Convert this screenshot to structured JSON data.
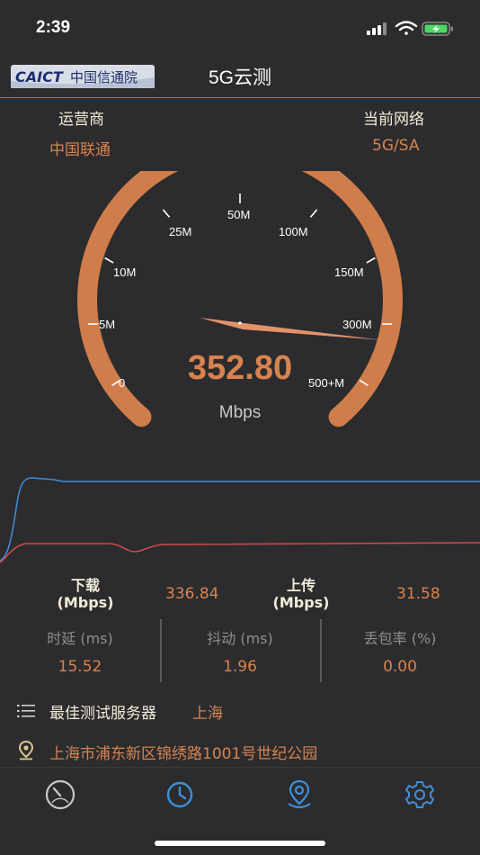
{
  "status_bar": {
    "time": "2:39"
  },
  "header": {
    "logo_text": "CAICT",
    "logo_cn": "中国信通院",
    "title": "5G云测"
  },
  "info": {
    "carrier_label": "运营商",
    "carrier_value": "中国联通",
    "network_label": "当前网络",
    "network_value": "5G/SA"
  },
  "gauge": {
    "tick_labels": [
      "0",
      "5M",
      "10M",
      "25M",
      "50M",
      "100M",
      "150M",
      "300M",
      "500+M"
    ],
    "speed": "352.80",
    "unit": "Mbps"
  },
  "metrics": {
    "download_label_1": "下载",
    "download_label_2": "(Mbps)",
    "download_value": "336.84",
    "upload_label_1": "上传",
    "upload_label_2": "(Mbps)",
    "upload_value": "31.58"
  },
  "stats": [
    {
      "label": "时延 (ms)",
      "value": "15.52"
    },
    {
      "label": "抖动 (ms)",
      "value": "1.96"
    },
    {
      "label": "丢包率 (%)",
      "value": "0.00"
    }
  ],
  "server": {
    "label": "最佳测试服务器",
    "value": "上海",
    "address": "上海市浦东新区锦绣路1001号世纪公园"
  },
  "tabs": [
    "speedometer-icon",
    "history-clock-icon",
    "location-pin-icon",
    "settings-gear-icon"
  ],
  "colors": {
    "accent": "#d8834f",
    "gauge": "#cf7d4b",
    "download_line": "#3f8fd8",
    "upload_line": "#d24a4a",
    "label": "#f3ecd8",
    "tab_icon": "#3f8fd8"
  }
}
